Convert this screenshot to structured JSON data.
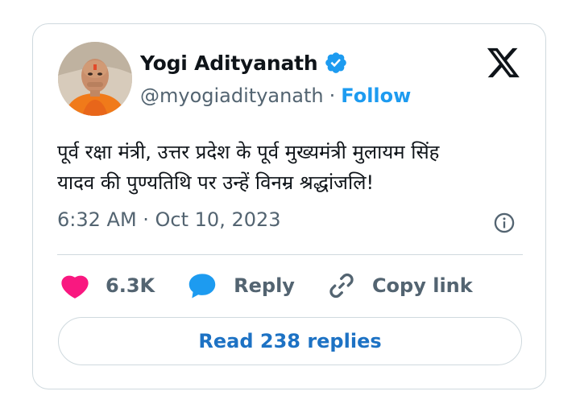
{
  "author": {
    "name": "Yogi Adityanath",
    "handle": "@myogiadityanath",
    "separator": "·",
    "follow_label": "Follow"
  },
  "tweet": {
    "line1": "पूर्व रक्षा मंत्री, उत्तर प्रदेश के पूर्व मुख्यमंत्री मुलायम सिंह",
    "line2": "यादव की पुण्यतिथि पर उन्हें विनम्र श्रद्धांजलि!",
    "timestamp": "6:32 AM · Oct 10, 2023"
  },
  "actions": {
    "likes_count": "6.3K",
    "reply_label": "Reply",
    "copy_link_label": "Copy link"
  },
  "read_replies_label": "Read 238 replies",
  "icons": {
    "verified": "verified-badge-icon",
    "x_logo": "x-logo-icon",
    "info": "info-icon",
    "like": "heart-icon",
    "reply": "speech-bubble-icon",
    "copy_link": "link-icon"
  },
  "colors": {
    "accent": "#1d9bf0",
    "like": "#f91880",
    "muted": "#536471",
    "text": "#0f1419",
    "border": "#cfd9de"
  }
}
